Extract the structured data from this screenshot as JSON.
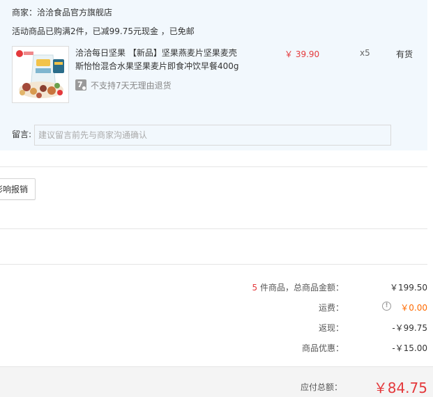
{
  "order": {
    "merchant": "商家：洽洽食品官方旗舰店",
    "promo": "活动商品已购满2件，已减99.75元现金 ，已免邮",
    "product": {
      "title": "洽洽每日坚果 【新品】坚果燕麦片坚果麦壳斯怡怡混合水果坚果麦片即食冲饮早餐400g",
      "price": "￥ 39.90",
      "qty": "x5",
      "stock": "有货",
      "return_badge": "7",
      "return_policy": "不支持7天无理由退货"
    },
    "message": {
      "label": "留言:",
      "placeholder": "建议留言前先与商家沟通确认"
    }
  },
  "invoice": {
    "button_label": "影响报销"
  },
  "summary": {
    "count": "5",
    "count_label": " 件商品，总商品金额：",
    "goods_amount": "￥199.50",
    "shipping_label": "运费：",
    "shipping_icon": "!",
    "shipping_value": "￥0.00",
    "rebate_label": "返现：",
    "rebate_value": "-￥99.75",
    "discount_label": "商品优惠：",
    "discount_value": "-￥15.00",
    "total_label": "应付总额：",
    "total_value": "￥84.75"
  },
  "colors": {
    "accent_red": "#e4393c",
    "accent_orange": "#ff6a00",
    "panel_bg": "#f2f8fd"
  }
}
